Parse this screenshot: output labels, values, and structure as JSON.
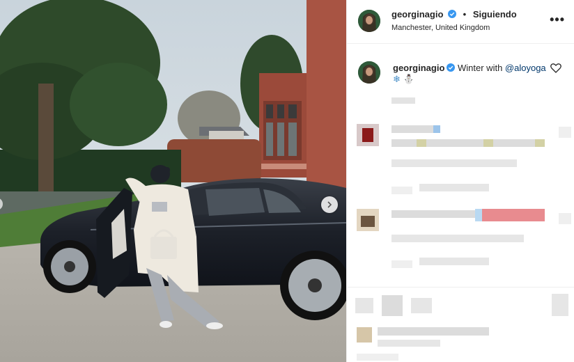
{
  "post": {
    "username": "georginagio",
    "follow_status": "Siguiendo",
    "separator": "•",
    "location": "Manchester, United Kingdom",
    "more_glyph": "•••",
    "caption_prefix": "Winter with ",
    "caption_mention": "@aloyoga",
    "caption_emojis": "❄ ⛄"
  },
  "colors": {
    "verified": "#3897f0",
    "mention": "#00376b",
    "text": "#262626"
  },
  "icons": [
    "verified-badge-icon",
    "more-options-icon",
    "heart-icon",
    "snowflake-icon",
    "snowman-icon",
    "chevron-right-icon"
  ]
}
